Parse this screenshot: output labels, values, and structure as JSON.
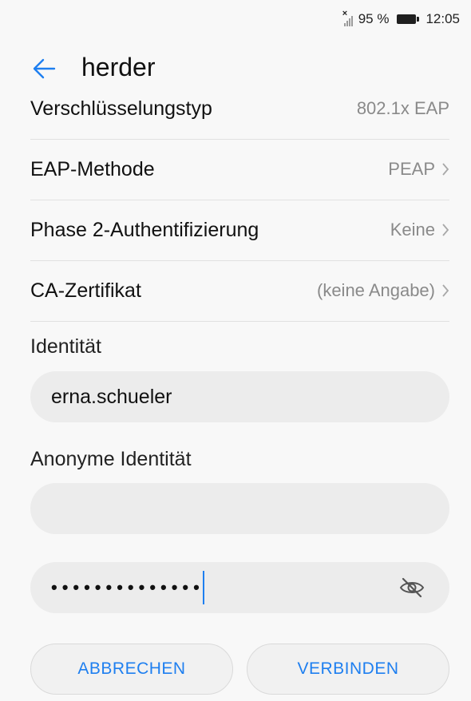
{
  "status_bar": {
    "battery": "95 %",
    "time": "12:05",
    "icons": [
      "no-sim-signal-icon",
      "battery-icon"
    ]
  },
  "toolbar": {
    "back_icon": "arrow-left-icon",
    "title": "herder"
  },
  "settings": [
    {
      "label": "Verschlüsselungstyp",
      "value": "802.1x EAP",
      "chevron": false
    },
    {
      "label": "EAP-Methode",
      "value": "PEAP",
      "chevron": true
    },
    {
      "label": "Phase 2-Authentifizierung",
      "value": "Keine",
      "chevron": true
    },
    {
      "label": "CA-Zertifikat",
      "value": "(keine Angabe)",
      "chevron": true
    }
  ],
  "identity": {
    "label": "Identität",
    "value": "erna.schueler"
  },
  "anonymous_identity": {
    "label": "Anonyme Identität",
    "value": ""
  },
  "password": {
    "masked_value": "••••••••••••••",
    "toggle_icon": "eye-off-icon"
  },
  "buttons": {
    "cancel": "ABBRECHEN",
    "connect": "VERBINDEN"
  },
  "colors": {
    "accent": "#1e7ff0",
    "background": "#f8f8f8",
    "field_bg": "#ececec",
    "secondary_text": "#8a8a8a"
  }
}
